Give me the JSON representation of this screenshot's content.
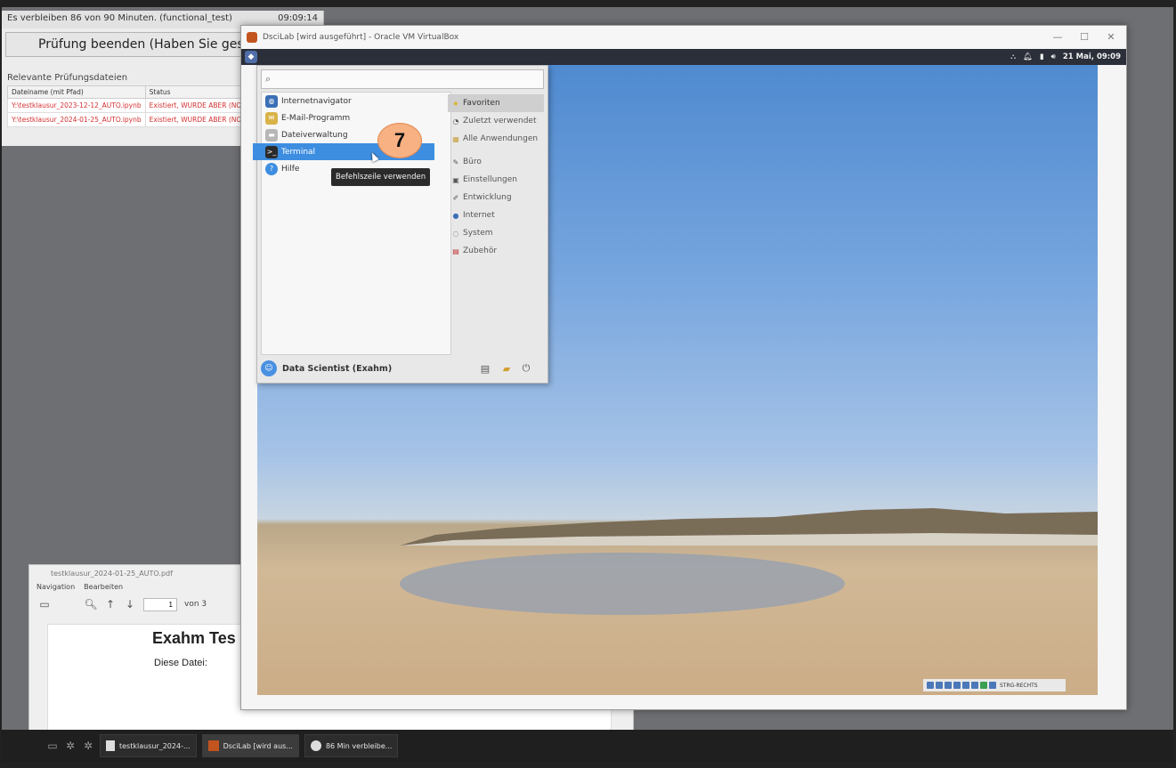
{
  "exam": {
    "time_remaining": "Es verbleiben 86 von 90 Minuten. (functional_test)",
    "clock": "09:09:14",
    "end_button": "Prüfung beenden (Haben Sie gespe",
    "files_label": "Relevante Prüfungsdateien",
    "columns": [
      "Dateiname (mit Pfad)",
      "Status"
    ],
    "rows": [
      {
        "file": "Y:\\testklausur_2023-12-12_AUTO.ipynb",
        "status": "Existiert, WURDE ABER (NOCH)"
      },
      {
        "file": "Y:\\testklausur_2024-01-25_AUTO.ipynb",
        "status": "Existiert, WURDE ABER (NOCH)"
      }
    ],
    "status_color": "#d43030"
  },
  "pdf": {
    "title": "testklausur_2024-01-25_AUTO.pdf",
    "menu": [
      "Navigation",
      "Bearbeiten"
    ],
    "page_value": "1",
    "page_total": "von 3",
    "heading": "Exahm Tes",
    "body_text": "Diese Datei:"
  },
  "taskbar": {
    "items": [
      {
        "label": "testklausur_2024-...",
        "icon": "document-icon"
      },
      {
        "label": "DsciLab [wird aus...",
        "icon": "virtualbox-icon"
      },
      {
        "label": "86 Min verbleibe...",
        "icon": "clock-icon"
      }
    ]
  },
  "vbox": {
    "title": "DsciLab [wird ausgeführt] - Oracle VM VirtualBox",
    "status_text": "STRG-RECHTS"
  },
  "vm_panel": {
    "datetime": "21 Mai, 09:09"
  },
  "menu": {
    "search_placeholder": "",
    "favorites": [
      {
        "label": "Internetnavigator",
        "icon": "globe-icon",
        "color": "#3b6fb6"
      },
      {
        "label": "E-Mail-Programm",
        "icon": "mail-icon",
        "color": "#d9b348"
      },
      {
        "label": "Dateiverwaltung",
        "icon": "folder-icon",
        "color": "#b7b7b7"
      },
      {
        "label": "Terminal",
        "icon": "terminal-icon",
        "color": "#2b2b2b"
      },
      {
        "label": "Hilfe",
        "icon": "help-icon",
        "color": "#3d8ee0"
      }
    ],
    "highlight_color": "#3d8ee0",
    "categories": [
      {
        "label": "Favoriten",
        "icon": "star-icon"
      },
      {
        "label": "Zuletzt verwendet",
        "icon": "recent-icon"
      },
      {
        "label": "Alle Anwendungen",
        "icon": "all-apps-icon"
      },
      {
        "label": "Büro",
        "icon": "office-icon"
      },
      {
        "label": "Einstellungen",
        "icon": "settings-icon"
      },
      {
        "label": "Entwicklung",
        "icon": "development-icon"
      },
      {
        "label": "Internet",
        "icon": "internet-icon"
      },
      {
        "label": "System",
        "icon": "system-icon"
      },
      {
        "label": "Zubehör",
        "icon": "accessories-icon"
      }
    ],
    "user": "Data Scientist (Exahm)",
    "tooltip": "Befehlszeile verwenden"
  },
  "annotation": {
    "step": "7",
    "color": "#f7b183"
  }
}
